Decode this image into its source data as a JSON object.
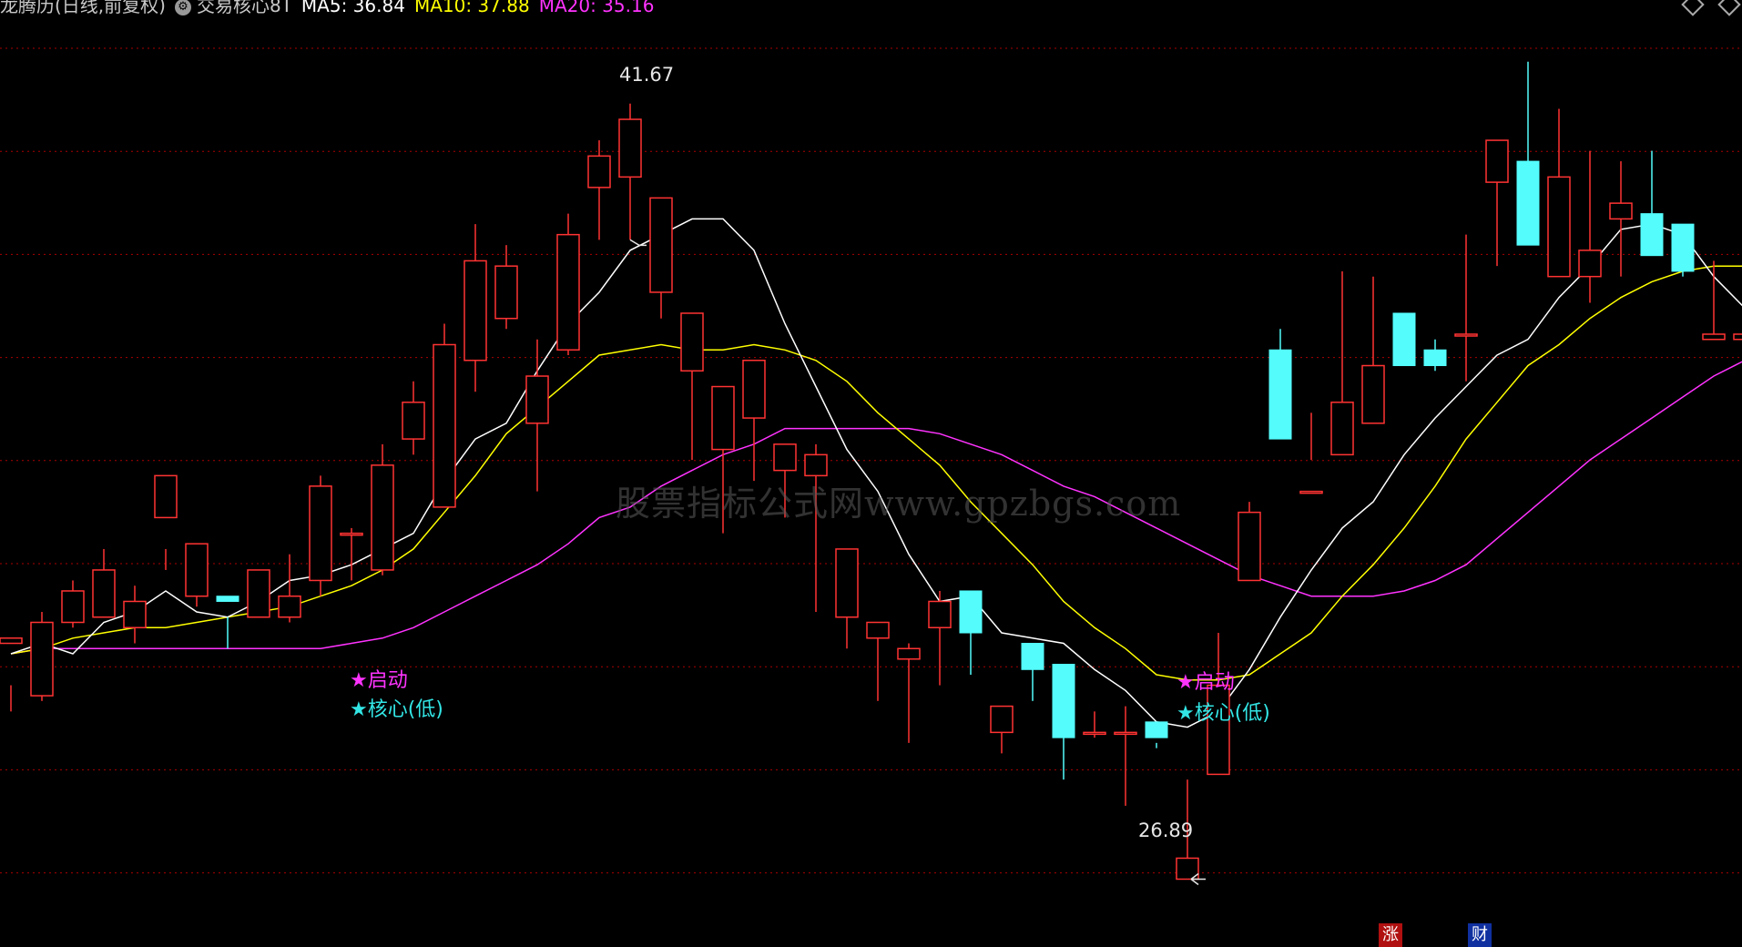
{
  "header": {
    "title": "龙腾历(日线,前复权)",
    "indicator_name": "交易核心8T",
    "ma5": "MA5: 36.84",
    "ma10": "MA10: 37.88",
    "ma20": "MA20: 35.16"
  },
  "watermark": "股票指标公式网www.gpzbgs.com",
  "signals": [
    {
      "launch": "★启动",
      "core": "★核心(低)"
    },
    {
      "launch": "★启动",
      "core": "★核心(低)"
    }
  ],
  "annotations": {
    "high": "41.67",
    "low": "26.89"
  },
  "badges": {
    "zhang": "涨",
    "cai": "财"
  },
  "colors": {
    "up": "#ff3333",
    "down": "#54fcfc",
    "ma5": "#ffffff",
    "ma10": "#ffff00",
    "ma20": "#ff33ff",
    "grid": "#aa0000",
    "background": "#000000"
  },
  "chart_data": {
    "type": "candlestick",
    "title": "龙腾历(日线,前复权)",
    "grid": true,
    "series": [
      {
        "name": "K",
        "ohlc": [
          [
            31.4,
            31.5,
            30.6,
            30.1
          ],
          [
            30.4,
            31.8,
            30.3,
            32.0
          ],
          [
            31.8,
            32.4,
            31.7,
            32.6
          ],
          [
            31.9,
            32.8,
            31.9,
            33.2
          ],
          [
            31.7,
            32.2,
            31.4,
            32.5
          ],
          [
            33.8,
            34.6,
            32.8,
            33.2
          ],
          [
            32.3,
            33.3,
            32.1,
            32.3
          ],
          [
            32.3,
            32.2,
            31.9,
            31.3
          ],
          [
            31.9,
            32.8,
            31.9,
            32.5
          ],
          [
            31.9,
            32.3,
            31.8,
            33.1
          ],
          [
            32.6,
            34.4,
            32.3,
            34.6
          ],
          [
            33.5,
            33.5,
            32.6,
            33.6
          ],
          [
            32.8,
            34.8,
            32.7,
            35.2
          ],
          [
            35.3,
            36.0,
            35.0,
            36.4
          ],
          [
            34.0,
            37.1,
            35.1,
            37.5
          ],
          [
            36.8,
            38.7,
            36.2,
            39.4
          ],
          [
            37.6,
            38.6,
            37.4,
            39.0
          ],
          [
            35.6,
            36.5,
            34.3,
            37.2
          ],
          [
            37.0,
            39.2,
            36.9,
            39.6
          ],
          [
            40.1,
            40.7,
            39.1,
            41.0
          ],
          [
            40.3,
            41.4,
            39.1,
            41.7
          ],
          [
            38.1,
            39.9,
            37.6,
            39.9
          ],
          [
            36.6,
            37.7,
            34.9,
            37.6
          ],
          [
            35.1,
            36.3,
            33.5,
            36.3
          ],
          [
            35.7,
            36.8,
            34.5,
            36.7
          ],
          [
            34.7,
            35.2,
            33.8,
            35.2
          ],
          [
            34.6,
            35.0,
            32.0,
            35.2
          ],
          [
            31.9,
            33.2,
            31.3,
            33.2
          ],
          [
            31.5,
            31.8,
            30.3,
            31.8
          ],
          [
            31.1,
            31.3,
            29.5,
            31.4
          ],
          [
            31.7,
            32.2,
            30.6,
            32.4
          ],
          [
            32.4,
            31.6,
            30.8,
            32.4
          ],
          [
            29.7,
            30.2,
            29.3,
            30.1
          ],
          [
            31.4,
            30.9,
            30.3,
            30.9
          ],
          [
            31.0,
            29.6,
            28.8,
            31.0
          ],
          [
            29.7,
            29.7,
            29.6,
            30.1
          ],
          [
            29.7,
            29.7,
            28.3,
            30.2
          ],
          [
            29.9,
            29.6,
            29.5,
            29.4
          ],
          [
            26.9,
            27.3,
            28.8,
            26.9
          ],
          [
            28.9,
            30.6,
            30.2,
            31.6
          ],
          [
            32.6,
            33.9,
            33.0,
            34.1
          ],
          [
            37.0,
            35.3,
            35.3,
            37.4
          ],
          [
            34.3,
            34.3,
            35.8,
            34.9
          ],
          [
            35.0,
            36.0,
            35.1,
            38.5
          ],
          [
            35.6,
            36.7,
            36.0,
            38.4
          ],
          [
            37.7,
            36.7,
            36.8,
            37.5
          ],
          [
            37.0,
            36.7,
            36.6,
            37.2
          ],
          [
            37.3,
            37.3,
            36.4,
            39.2
          ],
          [
            40.2,
            41.0,
            38.6,
            41.0
          ],
          [
            40.6,
            39.0,
            39.3,
            42.5
          ],
          [
            38.4,
            40.3,
            39.0,
            41.6
          ],
          [
            38.4,
            38.9,
            37.9,
            40.8
          ],
          [
            39.5,
            39.8,
            38.4,
            40.6
          ],
          [
            39.6,
            38.8,
            39.1,
            40.8
          ],
          [
            39.4,
            38.5,
            38.6,
            38.4
          ],
          [
            37.2,
            37.3,
            37.2,
            38.7
          ],
          [
            37.2,
            37.3,
            36.7,
            37.2
          ],
          [
            37.3,
            37.0,
            36.8,
            37.5
          ]
        ]
      },
      {
        "name": "MA5",
        "values": [
          31.2,
          31.4,
          31.2,
          31.8,
          32.0,
          32.4,
          32.0,
          31.9,
          32.2,
          32.6,
          32.7,
          32.9,
          33.2,
          33.5,
          34.5,
          35.3,
          35.6,
          36.6,
          37.5,
          38.1,
          38.9,
          39.2,
          39.5,
          39.5,
          38.9,
          37.5,
          36.3,
          35.1,
          34.3,
          33.1,
          32.2,
          32.3,
          31.6,
          31.5,
          31.4,
          30.9,
          30.5,
          29.9,
          29.8,
          30.1,
          30.9,
          31.9,
          32.8,
          33.6,
          34.1,
          35.0,
          35.7,
          36.3,
          36.9,
          37.2,
          38.0,
          38.6,
          39.3,
          39.4,
          39.2,
          38.4,
          37.8,
          37.3
        ]
      },
      {
        "name": "MA10",
        "values": [
          31.2,
          31.3,
          31.5,
          31.6,
          31.7,
          31.7,
          31.8,
          31.9,
          32.0,
          32.1,
          32.3,
          32.5,
          32.8,
          33.2,
          33.9,
          34.6,
          35.4,
          35.9,
          36.4,
          36.9,
          37.0,
          37.1,
          37.0,
          37.0,
          37.1,
          37.0,
          36.8,
          36.4,
          35.8,
          35.3,
          34.8,
          34.1,
          33.5,
          32.9,
          32.2,
          31.7,
          31.3,
          30.8,
          30.7,
          30.7,
          30.8,
          31.2,
          31.6,
          32.3,
          32.9,
          33.6,
          34.4,
          35.3,
          36.0,
          36.7,
          37.1,
          37.6,
          38.0,
          38.3,
          38.5,
          38.6,
          38.6,
          38.6
        ]
      },
      {
        "name": "MA20",
        "values": [
          31.2,
          31.3,
          31.3,
          31.3,
          31.3,
          31.3,
          31.3,
          31.3,
          31.3,
          31.3,
          31.3,
          31.4,
          31.5,
          31.7,
          32.0,
          32.3,
          32.6,
          32.9,
          33.3,
          33.8,
          34.0,
          34.4,
          34.7,
          35.0,
          35.2,
          35.5,
          35.5,
          35.5,
          35.5,
          35.5,
          35.4,
          35.2,
          35.0,
          34.7,
          34.4,
          34.2,
          33.9,
          33.6,
          33.3,
          33.0,
          32.7,
          32.5,
          32.3,
          32.3,
          32.3,
          32.4,
          32.6,
          32.9,
          33.4,
          33.9,
          34.4,
          34.9,
          35.3,
          35.7,
          36.1,
          36.5,
          36.8,
          37.1
        ]
      }
    ],
    "ylim": [
      26.3,
      42.6
    ]
  }
}
